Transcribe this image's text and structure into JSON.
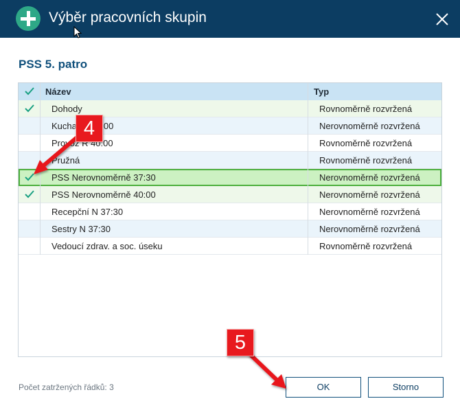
{
  "window": {
    "title": "Výběr pracovních skupin"
  },
  "section_title": "PSS 5. patro",
  "table": {
    "columns": [
      "Název",
      "Typ"
    ],
    "rows": [
      {
        "name": "Dohody",
        "type": "Rovnoměrně rozvržená",
        "checked": true
      },
      {
        "name": "Kuchařky 40:00",
        "type": "Nerovnoměrně rozvržená",
        "checked": false
      },
      {
        "name": "Provoz R 40:00",
        "type": "Rovnoměrně rozvržená",
        "checked": false
      },
      {
        "name": "Pružná",
        "type": "Rovnoměrně rozvržená",
        "checked": false
      },
      {
        "name": "PSS Nerovnoměrně 37:30",
        "type": "Nerovnoměrně rozvržená",
        "checked": true,
        "selected": true
      },
      {
        "name": "PSS Nerovnoměrně 40:00",
        "type": "Nerovnoměrně rozvržená",
        "checked": true
      },
      {
        "name": "Recepční N 37:30",
        "type": "Nerovnoměrně rozvržená",
        "checked": false
      },
      {
        "name": "Sestry N 37:30",
        "type": "Nerovnoměrně rozvržená",
        "checked": false
      },
      {
        "name": "Vedoucí zdrav. a soc. úseku",
        "type": "Rovnoměrně rozvržená",
        "checked": false
      }
    ]
  },
  "footer": {
    "count_label": "Počet zatržených řádků: 3"
  },
  "buttons": {
    "ok": "OK",
    "cancel": "Storno"
  },
  "annotations": {
    "step4": "4",
    "step5": "5"
  },
  "colors": {
    "titlebar": "#0c3d62",
    "accent": "#2ea887",
    "check": "#1aa082",
    "header": "#c9e3f4",
    "selected": "#ccf1c2",
    "annotation": "#e8191e"
  }
}
